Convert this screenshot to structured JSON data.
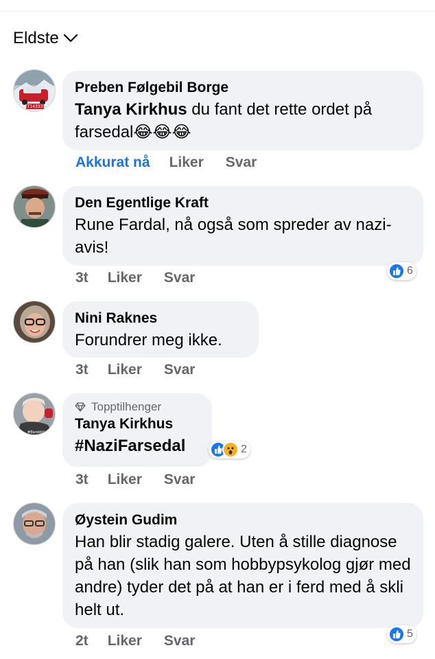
{
  "sort": {
    "label": "Eldste"
  },
  "comments": [
    {
      "author": "Preben Følgebil Borge",
      "mention": "Tanya Kirkhus",
      "text": " du fant det rette ordet på farsedal😂😂😂",
      "time": "Akkurat nå",
      "like": "Liker",
      "reply": "Svar"
    },
    {
      "author": "Den Egentlige Kraft",
      "text": "Rune Fardal, nå også som spreder av nazi-avis!",
      "time": "3t",
      "like": "Liker",
      "reply": "Svar",
      "reaction_count": "6"
    },
    {
      "author": "Nini Raknes",
      "text": "Forundrer meg ikke.",
      "time": "3t",
      "like": "Liker",
      "reply": "Svar"
    },
    {
      "badge": "Topptilhenger",
      "author": "Tanya Kirkhus",
      "text": "#NaziFarsedal",
      "time": "3t",
      "like": "Liker",
      "reply": "Svar",
      "reaction_count": "2"
    },
    {
      "author": "Øystein Gudim",
      "text": "Han blir stadig galere.  Uten å stille diagnose på han (slik han som hobbypsykolog gjør med andre) tyder det på at han er i ferd med å skli helt ut.",
      "time": "2t",
      "like": "Liker",
      "reply": "Svar",
      "reaction_count": "5"
    }
  ],
  "avatar_texts": {
    "plate": "ZT143333",
    "sign": "#Bareblid"
  },
  "colors": {
    "accent": "#1b74e4",
    "bubble": "#f0f2f5",
    "meta": "#65676b",
    "like": "#1877f2",
    "wow": "#f7b125"
  },
  "icons": [
    "chevron-down-icon",
    "diamond-badge-icon",
    "like-reaction-icon",
    "wow-reaction-icon"
  ]
}
